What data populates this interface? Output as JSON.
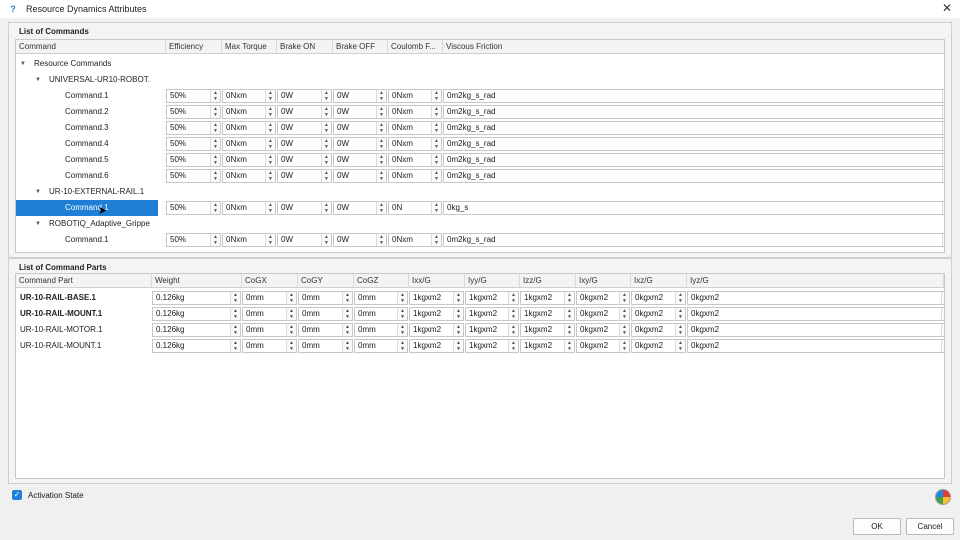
{
  "window": {
    "title": "Resource Dynamics Attributes",
    "app_icon": "?"
  },
  "commands_group": {
    "title": "List of Commands",
    "columns": [
      "Command",
      "Efficiency",
      "Max Torque",
      "Brake ON",
      "Brake OFF",
      "Coulomb F...",
      "Viscous Friction"
    ],
    "root_label": "Resource Commands",
    "nodes": [
      {
        "label": "UNIVERSAL-UR10-ROBOT.",
        "commands": [
          {
            "label": "Command.1",
            "values": [
              "50%",
              "0Nxm",
              "0W",
              "0W",
              "0Nxm",
              "0m2kg_s_rad"
            ]
          },
          {
            "label": "Command.2",
            "values": [
              "50%",
              "0Nxm",
              "0W",
              "0W",
              "0Nxm",
              "0m2kg_s_rad"
            ]
          },
          {
            "label": "Command.3",
            "values": [
              "50%",
              "0Nxm",
              "0W",
              "0W",
              "0Nxm",
              "0m2kg_s_rad"
            ]
          },
          {
            "label": "Command.4",
            "values": [
              "50%",
              "0Nxm",
              "0W",
              "0W",
              "0Nxm",
              "0m2kg_s_rad"
            ]
          },
          {
            "label": "Command.5",
            "values": [
              "50%",
              "0Nxm",
              "0W",
              "0W",
              "0Nxm",
              "0m2kg_s_rad"
            ]
          },
          {
            "label": "Command.6",
            "values": [
              "50%",
              "0Nxm",
              "0W",
              "0W",
              "0Nxm",
              "0m2kg_s_rad"
            ]
          }
        ]
      },
      {
        "label": "UR-10-EXTERNAL-RAIL.1",
        "commands": [
          {
            "label": "Command.1",
            "values": [
              "50%",
              "0Nxm",
              "0W",
              "0W",
              "0N",
              "0kg_s"
            ]
          }
        ]
      },
      {
        "label": "ROBOTIQ_Adaptive_Grippе",
        "commands": [
          {
            "label": "Command.1",
            "values": [
              "50%",
              "0Nxm",
              "0W",
              "0W",
              "0Nxm",
              "0m2kg_s_rad"
            ]
          }
        ]
      }
    ]
  },
  "parts_group": {
    "title": "List of Command Parts",
    "columns": [
      "Command Part",
      "Weight",
      "CoGX",
      "CoGY",
      "CoGZ",
      "Ixx/G",
      "Iyy/G",
      "Izz/G",
      "Ixy/G",
      "Ixz/G",
      "Iyz/G"
    ],
    "rows": [
      {
        "label": "UR-10-RAIL-BASE.1",
        "values": [
          "0.126kg",
          "0mm",
          "0mm",
          "0mm",
          "1kgxm2",
          "1kgxm2",
          "1kgxm2",
          "0kgxm2",
          "0kgxm2",
          "0kgxm2"
        ]
      },
      {
        "label": "UR-10-RAIL-MOUNT.1",
        "values": [
          "0.126kg",
          "0mm",
          "0mm",
          "0mm",
          "1kgxm2",
          "1kgxm2",
          "1kgxm2",
          "0kgxm2",
          "0kgxm2",
          "0kgxm2"
        ]
      },
      {
        "label": "UR-10-RAIL-MOTOR.1",
        "values": [
          "0.126kg",
          "0mm",
          "0mm",
          "0mm",
          "1kgxm2",
          "1kgxm2",
          "1kgxm2",
          "0kgxm2",
          "0kgxm2",
          "0kgxm2"
        ]
      },
      {
        "label": "UR-10-RAIL-MOUNT.1",
        "values": [
          "0.126kg",
          "0mm",
          "0mm",
          "0mm",
          "1kgxm2",
          "1kgxm2",
          "1kgxm2",
          "0kgxm2",
          "0kgxm2",
          "0kgxm2"
        ]
      }
    ]
  },
  "activation": {
    "label": "Activation State",
    "checked": true
  },
  "buttons": {
    "ok": "OK",
    "cancel": "Cancel"
  },
  "colors": {
    "selection": "#1f7fd6",
    "accent": "#1f7fd6"
  },
  "icons": {
    "close": "close-icon",
    "expand": "triangle-down-icon",
    "palette": "color-palette-icon"
  }
}
